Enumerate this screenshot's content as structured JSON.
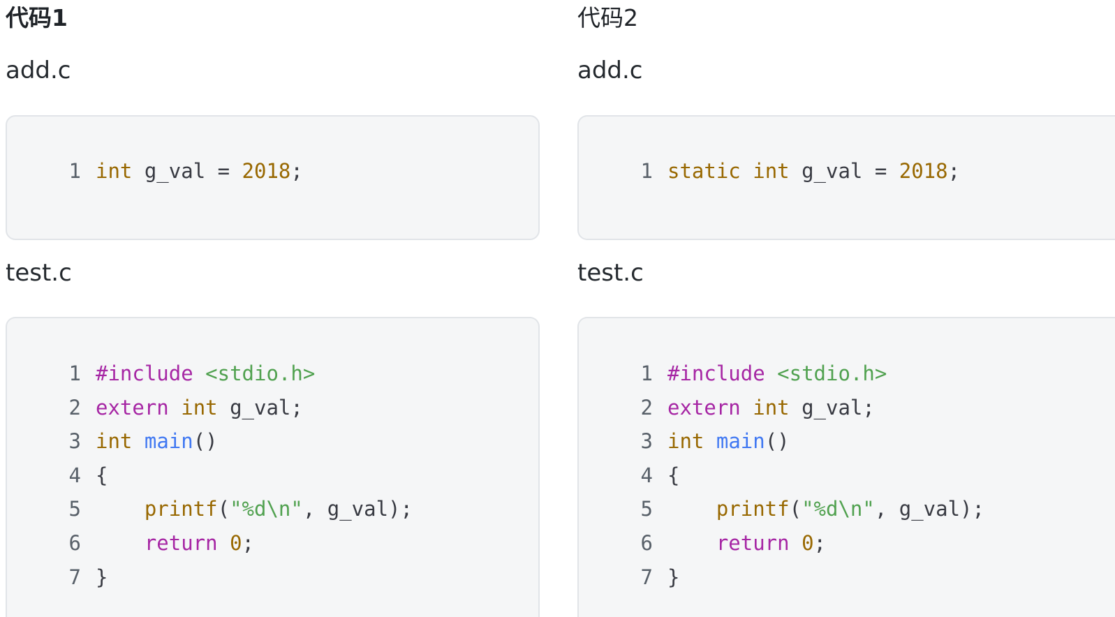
{
  "left": {
    "heading": "代码1",
    "add_file": "add.c",
    "add_code": [
      {
        "n": "1",
        "tokens": [
          {
            "t": "int",
            "c": "type"
          },
          {
            "t": " g_val = ",
            "c": "plain"
          },
          {
            "t": "2018",
            "c": "num"
          },
          {
            "t": ";",
            "c": "plain"
          }
        ]
      }
    ],
    "test_file": "test.c",
    "test_code": [
      {
        "n": "1",
        "tokens": [
          {
            "t": "#include",
            "c": "kw"
          },
          {
            "t": " ",
            "c": "plain"
          },
          {
            "t": "<stdio.h>",
            "c": "str"
          }
        ]
      },
      {
        "n": "2",
        "tokens": [
          {
            "t": "extern",
            "c": "kw"
          },
          {
            "t": " ",
            "c": "plain"
          },
          {
            "t": "int",
            "c": "type"
          },
          {
            "t": " g_val;",
            "c": "plain"
          }
        ]
      },
      {
        "n": "3",
        "tokens": [
          {
            "t": "int",
            "c": "type"
          },
          {
            "t": " ",
            "c": "plain"
          },
          {
            "t": "main",
            "c": "fn"
          },
          {
            "t": "()",
            "c": "plain"
          }
        ]
      },
      {
        "n": "4",
        "tokens": [
          {
            "t": "{",
            "c": "plain"
          }
        ]
      },
      {
        "n": "5",
        "tokens": [
          {
            "t": "    ",
            "c": "plain"
          },
          {
            "t": "printf",
            "c": "call"
          },
          {
            "t": "(",
            "c": "plain"
          },
          {
            "t": "\"%d\\n\"",
            "c": "str"
          },
          {
            "t": ", g_val);",
            "c": "plain"
          }
        ]
      },
      {
        "n": "6",
        "tokens": [
          {
            "t": "    ",
            "c": "plain"
          },
          {
            "t": "return",
            "c": "kw"
          },
          {
            "t": " ",
            "c": "plain"
          },
          {
            "t": "0",
            "c": "num"
          },
          {
            "t": ";",
            "c": "plain"
          }
        ]
      },
      {
        "n": "7",
        "tokens": [
          {
            "t": "}",
            "c": "plain"
          }
        ]
      }
    ]
  },
  "right": {
    "heading": "代码2",
    "add_file": "add.c",
    "add_code": [
      {
        "n": "1",
        "tokens": [
          {
            "t": "static",
            "c": "type"
          },
          {
            "t": " ",
            "c": "plain"
          },
          {
            "t": "int",
            "c": "type"
          },
          {
            "t": " g_val = ",
            "c": "plain"
          },
          {
            "t": "2018",
            "c": "num"
          },
          {
            "t": ";",
            "c": "plain"
          }
        ]
      }
    ],
    "test_file": "test.c",
    "test_code": [
      {
        "n": "1",
        "tokens": [
          {
            "t": "#include",
            "c": "kw"
          },
          {
            "t": " ",
            "c": "plain"
          },
          {
            "t": "<stdio.h>",
            "c": "str"
          }
        ]
      },
      {
        "n": "2",
        "tokens": [
          {
            "t": "extern",
            "c": "kw"
          },
          {
            "t": " ",
            "c": "plain"
          },
          {
            "t": "int",
            "c": "type"
          },
          {
            "t": " g_val;",
            "c": "plain"
          }
        ]
      },
      {
        "n": "3",
        "tokens": [
          {
            "t": "int",
            "c": "type"
          },
          {
            "t": " ",
            "c": "plain"
          },
          {
            "t": "main",
            "c": "fn"
          },
          {
            "t": "()",
            "c": "plain"
          }
        ]
      },
      {
        "n": "4",
        "tokens": [
          {
            "t": "{",
            "c": "plain"
          }
        ]
      },
      {
        "n": "5",
        "tokens": [
          {
            "t": "    ",
            "c": "plain"
          },
          {
            "t": "printf",
            "c": "call"
          },
          {
            "t": "(",
            "c": "plain"
          },
          {
            "t": "\"%d\\n\"",
            "c": "str"
          },
          {
            "t": ", g_val);",
            "c": "plain"
          }
        ]
      },
      {
        "n": "6",
        "tokens": [
          {
            "t": "    ",
            "c": "plain"
          },
          {
            "t": "return",
            "c": "kw"
          },
          {
            "t": " ",
            "c": "plain"
          },
          {
            "t": "0",
            "c": "num"
          },
          {
            "t": ";",
            "c": "plain"
          }
        ]
      },
      {
        "n": "7",
        "tokens": [
          {
            "t": "}",
            "c": "plain"
          }
        ]
      }
    ]
  },
  "colors": {
    "keyword": "#a626a4",
    "type": "#986801",
    "number": "#986801",
    "function": "#4078f2",
    "string": "#50a14f",
    "code_background": "#f5f6f7",
    "code_border": "#e1e4e8"
  }
}
